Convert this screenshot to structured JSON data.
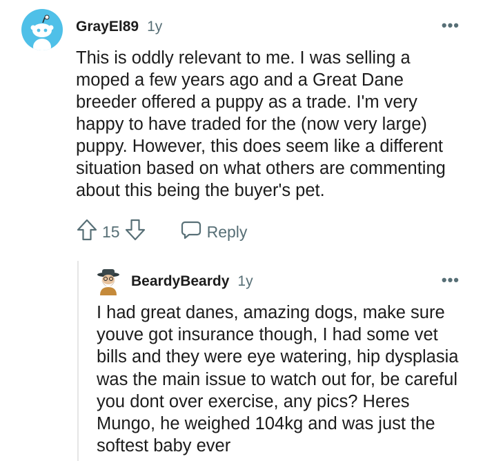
{
  "comment": {
    "author": "GrayEl89",
    "age": "1y",
    "more": "•••",
    "body": "This is oddly relevant to me. I was selling a moped a few years ago and a Great Dane breeder offered a puppy as a trade. I'm very happy to have traded for the (now very large) puppy. However, this does seem like a different situation based on what others are commenting about this being the buyer's pet.",
    "score": "15",
    "reply_label": "Reply"
  },
  "reply": {
    "author": "BeardyBeardy",
    "age": "1y",
    "more": "•••",
    "body": "I had great danes, amazing dogs, make sure youve got insurance though, I had some vet bills and they were eye watering, hip dysplasia was the main issue to watch out for, be careful you dont over exercise, any pics? Heres Mungo, he weighed 104kg and was just the softest baby ever"
  },
  "colors": {
    "avatar_bg": "#4fc0e8",
    "text": "#1c1c1c",
    "meta": "#576f76"
  },
  "icons": [
    "snoo-avatar-icon",
    "upvote-arrow-icon",
    "downvote-arrow-icon",
    "reply-bubble-icon",
    "bearded-avatar-icon"
  ]
}
